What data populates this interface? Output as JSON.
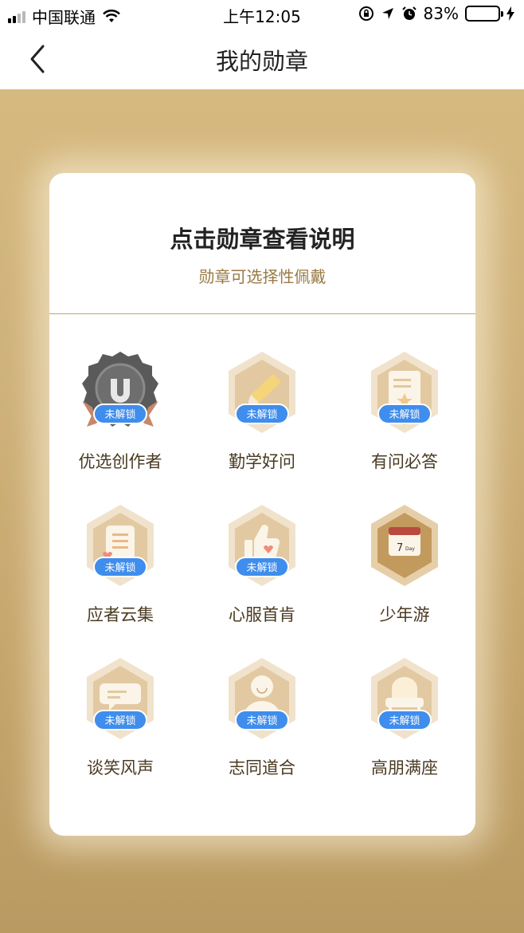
{
  "status_bar": {
    "carrier": "中国联通",
    "time": "上午12:05",
    "battery": "83%"
  },
  "nav": {
    "title": "我的勋章"
  },
  "card": {
    "title": "点击勋章查看说明",
    "subtitle": "勋章可选择性佩戴"
  },
  "badges": [
    {
      "name": "优选创作者",
      "lock": "未解锁",
      "icon": "award-medal-icon"
    },
    {
      "name": "勤学好问",
      "lock": "未解锁",
      "icon": "pencil-icon"
    },
    {
      "name": "有问必答",
      "lock": "未解锁",
      "icon": "note-star-icon"
    },
    {
      "name": "应者云集",
      "lock": "未解锁",
      "icon": "list-heart-icon"
    },
    {
      "name": "心服首肯",
      "lock": "未解锁",
      "icon": "thumbs-up-icon"
    },
    {
      "name": "少年游",
      "lock": "",
      "icon": "calendar-icon",
      "icon_text": "7",
      "icon_text_small": "Day"
    },
    {
      "name": "谈笑风声",
      "lock": "未解锁",
      "icon": "chat-bubble-icon"
    },
    {
      "name": "志同道合",
      "lock": "未解锁",
      "icon": "person-icon"
    },
    {
      "name": "高朋满座",
      "lock": "未解锁",
      "icon": "sofa-icon"
    }
  ],
  "colors": {
    "accent_gold": "#c7a467",
    "lock_blue": "#3f8dec",
    "battery_green": "#4cd964"
  }
}
